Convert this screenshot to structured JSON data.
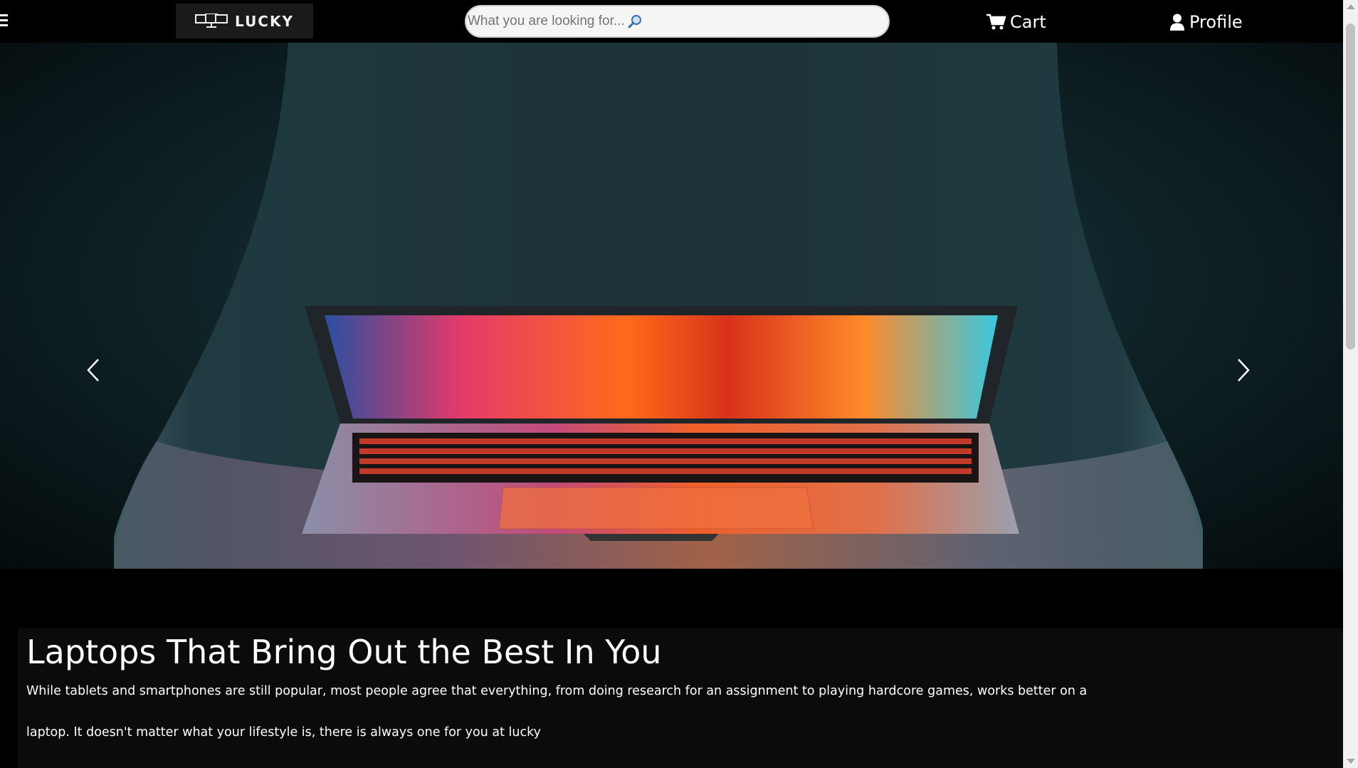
{
  "header": {
    "brand": "LUCKY",
    "search_placeholder": "What you are looking for...",
    "cart_label": "Cart",
    "profile_label": "Profile"
  },
  "hero": {
    "image_alt": "Laptop on a chair"
  },
  "content": {
    "heading": "Laptops That Bring Out the Best In You",
    "body": "While tablets and smartphones are still popular, most people agree that everything, from doing research for an assignment to playing hardcore games, works better on a laptop. It doesn't matter what your lifestyle is, there is always one for you at lucky"
  },
  "icons": {
    "menu": "hamburger-icon",
    "logo": "monitors-icon",
    "search": "magnifier-icon",
    "cart": "cart-icon",
    "profile": "user-icon",
    "prev": "chevron-left-icon",
    "next": "chevron-right-icon"
  },
  "colors": {
    "background": "#000000",
    "search_bg": "#f7f4f4",
    "content_bg": "#0b0b0b",
    "logo_bg": "#1a1a1a"
  }
}
